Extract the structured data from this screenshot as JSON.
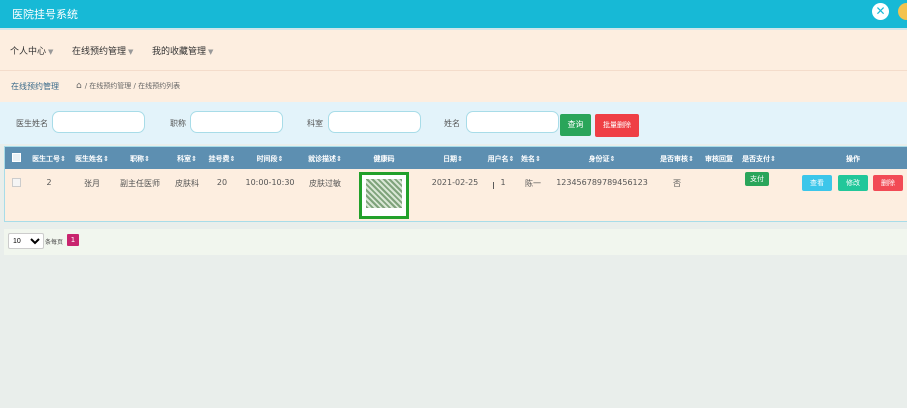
{
  "app": {
    "title": "医院挂号系统",
    "close_icon": "close-icon"
  },
  "menu": [
    {
      "label": "个人中心"
    },
    {
      "label": "在线预约管理"
    },
    {
      "label": "我的收藏管理"
    }
  ],
  "breadcrumb": {
    "title": "在线预约管理",
    "path": "/ 在线预约管理 / 在线预约列表"
  },
  "search": {
    "fields": [
      {
        "label": "医生姓名",
        "placeholder": ""
      },
      {
        "label": "职称",
        "placeholder": ""
      },
      {
        "label": "科室",
        "placeholder": ""
      },
      {
        "label": "姓名",
        "placeholder": ""
      }
    ],
    "search_label": "查询",
    "batch_delete_label": "批量删除"
  },
  "table": {
    "headers": [
      "医生工号",
      "医生姓名",
      "职称",
      "科室",
      "挂号费",
      "时间段",
      "就诊描述",
      "健康码",
      "日期",
      "用户名",
      "姓名",
      "身份证",
      "是否审核",
      "审核回复",
      "是否支付",
      "操作"
    ],
    "row": {
      "doctor_id": "2",
      "doctor_name": "张月",
      "title": "副主任医师",
      "department": "皮肤科",
      "fee": "20",
      "time_slot": "10:00-10:30",
      "description": "皮肤过敏",
      "date": "2021-02-25",
      "username": "1",
      "name": "陈一",
      "id_card": "123456789789456123",
      "reviewed": "否",
      "reply": "",
      "pay_label": "支付",
      "view_label": "查看",
      "edit_label": "修改",
      "delete_label": "删除"
    }
  },
  "pagination": {
    "page_size": "10",
    "per_page_text": "条每页",
    "current_page": "1"
  }
}
